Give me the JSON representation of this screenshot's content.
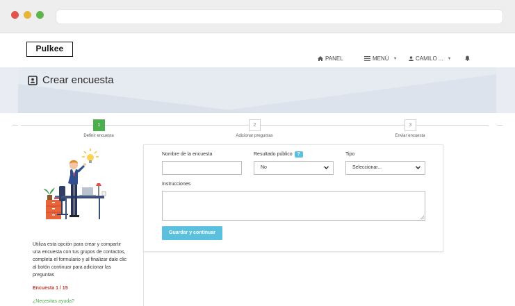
{
  "app": {
    "logo": "Pulkee"
  },
  "nav": {
    "panel": "PANEL",
    "menu": "MENÚ",
    "user": "CAMILO ..."
  },
  "page": {
    "title": "Crear encuesta"
  },
  "steps": [
    {
      "number": "1",
      "label": "Definir encuesta",
      "active": true
    },
    {
      "number": "2",
      "label": "Adicionar preguntas",
      "active": false
    },
    {
      "number": "3",
      "label": "Enviar encuesta",
      "active": false
    }
  ],
  "sidebar": {
    "description": "Utiliza esta opción para crear y compartir una encuesta con tus grupos de contactos, completa el formulario y al finalizar dale clic al botón continuar para adicionar las preguntas",
    "count": "Encuesta 1 / 15",
    "help": "¿Necesitas ayuda?"
  },
  "form": {
    "name_label": "Nombre de la encuesta",
    "name_value": "",
    "public_label": "Resultado público",
    "public_info": "?",
    "public_value": "No",
    "type_label": "Tipo",
    "type_value": "Seleccionar...",
    "instructions_label": "Instrucciones",
    "instructions_value": "",
    "submit": "Guardar y continuar"
  },
  "colors": {
    "accent": "#5bc0de",
    "step_active": "#4cae4c",
    "count": "#c0392b",
    "help": "#4cae4c"
  }
}
